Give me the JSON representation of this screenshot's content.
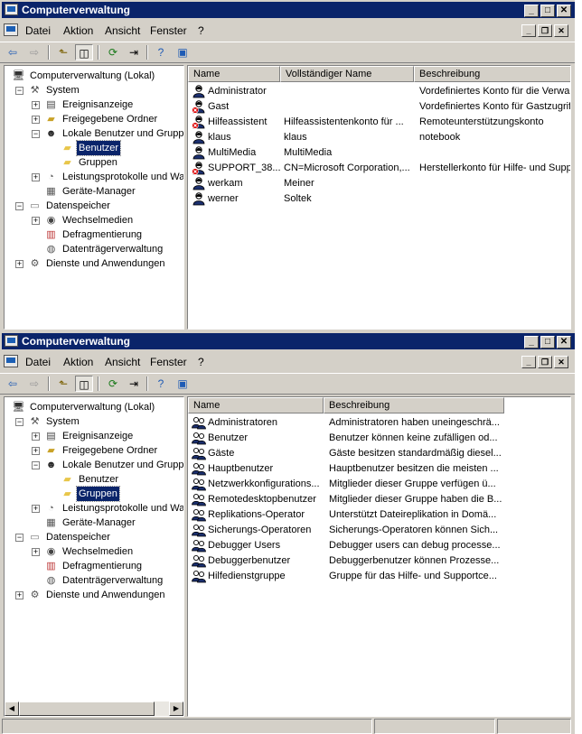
{
  "window1": {
    "title": "Computerverwaltung",
    "menu": [
      "Datei",
      "Aktion",
      "Ansicht",
      "Fenster",
      "?"
    ],
    "tree": [
      {
        "label": "Computerverwaltung (Lokal)",
        "icon": "computer-icon",
        "level": 0,
        "expander": ""
      },
      {
        "label": "System",
        "icon": "tools-icon",
        "level": 1,
        "expander": "-"
      },
      {
        "label": "Ereignisanzeige",
        "icon": "event-viewer-icon",
        "level": 2,
        "expander": "+"
      },
      {
        "label": "Freigegebene Ordner",
        "icon": "shared-folder-icon",
        "level": 2,
        "expander": "+"
      },
      {
        "label": "Lokale Benutzer und Gruppen",
        "icon": "users-icon",
        "level": 2,
        "expander": "-"
      },
      {
        "label": "Benutzer",
        "icon": "folder-icon",
        "level": 3,
        "expander": "",
        "selected": true
      },
      {
        "label": "Gruppen",
        "icon": "folder-icon",
        "level": 3,
        "expander": ""
      },
      {
        "label": "Leistungsprotokolle und Warnungen",
        "icon": "performance-icon",
        "level": 2,
        "expander": "+"
      },
      {
        "label": "Geräte-Manager",
        "icon": "device-manager-icon",
        "level": 2,
        "expander": ""
      },
      {
        "label": "Datenspeicher",
        "icon": "storage-icon",
        "level": 1,
        "expander": "-"
      },
      {
        "label": "Wechselmedien",
        "icon": "removable-media-icon",
        "level": 2,
        "expander": "+"
      },
      {
        "label": "Defragmentierung",
        "icon": "defrag-icon",
        "level": 2,
        "expander": ""
      },
      {
        "label": "Datenträgerverwaltung",
        "icon": "disk-management-icon",
        "level": 2,
        "expander": ""
      },
      {
        "label": "Dienste und Anwendungen",
        "icon": "services-icon",
        "level": 1,
        "expander": "+"
      }
    ],
    "columns": [
      "Name",
      "Vollständiger Name",
      "Beschreibung"
    ],
    "rows": [
      {
        "name": "Administrator",
        "fullname": "",
        "desc": "Vordefiniertes Konto für die Verwaltung",
        "disabled": false
      },
      {
        "name": "Gast",
        "fullname": "",
        "desc": "Vordefiniertes Konto für Gastzugriff",
        "disabled": true
      },
      {
        "name": "Hilfeassistent",
        "fullname": "Hilfeassistentenkonto für ...",
        "desc": "Remoteunterstützungskonto",
        "disabled": true
      },
      {
        "name": "klaus",
        "fullname": "klaus",
        "desc": "notebook",
        "disabled": false
      },
      {
        "name": "MultiMedia",
        "fullname": "MultiMedia",
        "desc": "",
        "disabled": false
      },
      {
        "name": "SUPPORT_38...",
        "fullname": "CN=Microsoft Corporation,...",
        "desc": "Herstellerkonto für Hilfe- und Support",
        "disabled": true
      },
      {
        "name": "werkam",
        "fullname": "Meiner",
        "desc": "",
        "disabled": false
      },
      {
        "name": "werner",
        "fullname": "Soltek",
        "desc": "",
        "disabled": false
      }
    ]
  },
  "window2": {
    "title": "Computerverwaltung",
    "menu": [
      "Datei",
      "Aktion",
      "Ansicht",
      "Fenster",
      "?"
    ],
    "tree": [
      {
        "label": "Computerverwaltung (Lokal)",
        "icon": "computer-icon",
        "level": 0,
        "expander": ""
      },
      {
        "label": "System",
        "icon": "tools-icon",
        "level": 1,
        "expander": "-"
      },
      {
        "label": "Ereignisanzeige",
        "icon": "event-viewer-icon",
        "level": 2,
        "expander": "+"
      },
      {
        "label": "Freigegebene Ordner",
        "icon": "shared-folder-icon",
        "level": 2,
        "expander": "+"
      },
      {
        "label": "Lokale Benutzer und Gruppen",
        "icon": "users-icon",
        "level": 2,
        "expander": "-"
      },
      {
        "label": "Benutzer",
        "icon": "folder-icon",
        "level": 3,
        "expander": ""
      },
      {
        "label": "Gruppen",
        "icon": "folder-icon",
        "level": 3,
        "expander": "",
        "selected": true
      },
      {
        "label": "Leistungsprotokolle und Warnungen",
        "icon": "performance-icon",
        "level": 2,
        "expander": "+"
      },
      {
        "label": "Geräte-Manager",
        "icon": "device-manager-icon",
        "level": 2,
        "expander": ""
      },
      {
        "label": "Datenspeicher",
        "icon": "storage-icon",
        "level": 1,
        "expander": "-"
      },
      {
        "label": "Wechselmedien",
        "icon": "removable-media-icon",
        "level": 2,
        "expander": "+"
      },
      {
        "label": "Defragmentierung",
        "icon": "defrag-icon",
        "level": 2,
        "expander": ""
      },
      {
        "label": "Datenträgerverwaltung",
        "icon": "disk-management-icon",
        "level": 2,
        "expander": ""
      },
      {
        "label": "Dienste und Anwendungen",
        "icon": "services-icon",
        "level": 1,
        "expander": "+"
      }
    ],
    "columns": [
      "Name",
      "Beschreibung"
    ],
    "rows": [
      {
        "name": "Administratoren",
        "desc": "Administratoren haben uneingeschrä..."
      },
      {
        "name": "Benutzer",
        "desc": "Benutzer können keine zufälligen od..."
      },
      {
        "name": "Gäste",
        "desc": "Gäste besitzen standardmäßig diesel..."
      },
      {
        "name": "Hauptbenutzer",
        "desc": "Hauptbenutzer besitzen die meisten ..."
      },
      {
        "name": "Netzwerkkonfigurations...",
        "desc": "Mitglieder dieser Gruppe verfügen ü..."
      },
      {
        "name": "Remotedesktopbenutzer",
        "desc": "Mitglieder dieser Gruppe haben die B..."
      },
      {
        "name": "Replikations-Operator",
        "desc": "Unterstützt Dateireplikation in Domä..."
      },
      {
        "name": "Sicherungs-Operatoren",
        "desc": "Sicherungs-Operatoren können Sich..."
      },
      {
        "name": "Debugger Users",
        "desc": "Debugger users can debug processe..."
      },
      {
        "name": "Debuggerbenutzer",
        "desc": "Debuggerbenutzer können Prozesse..."
      },
      {
        "name": "Hilfedienstgruppe",
        "desc": "Gruppe für das Hilfe- und Supportce..."
      }
    ]
  },
  "colors": {
    "titlebar": "#0a246a",
    "face": "#d4d0c8",
    "selection": "#0a246a"
  }
}
